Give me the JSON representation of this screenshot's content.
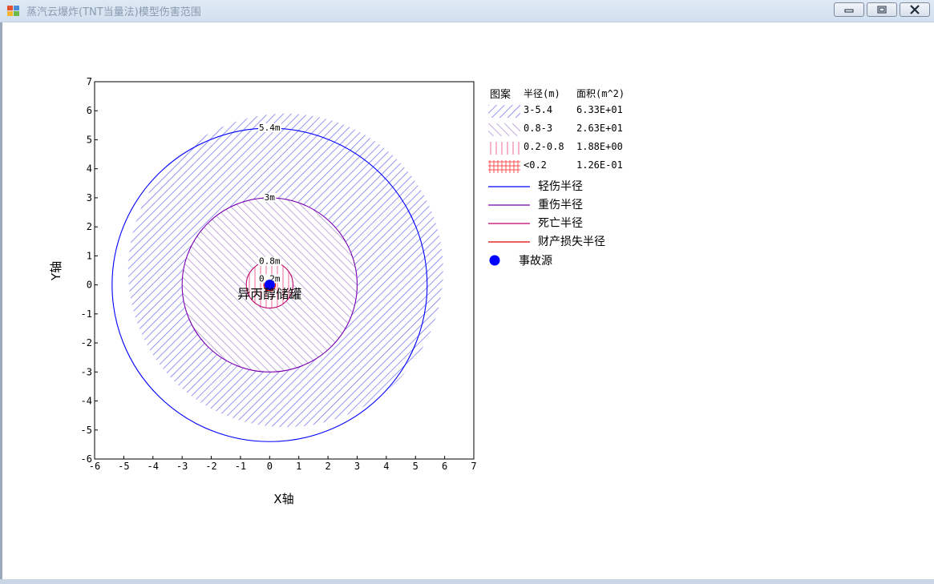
{
  "window": {
    "title": "蒸汽云爆炸(TNT当量法)模型伤害范围",
    "minimize_icon": "minimize-icon",
    "maximize_icon": "maximize-icon",
    "close_icon": "close-icon"
  },
  "chart_data": {
    "type": "scatter",
    "xlabel": "X轴",
    "ylabel": "Y轴",
    "xlim": [
      -6,
      7
    ],
    "ylim": [
      -6,
      7
    ],
    "xticks": [
      -6,
      -5,
      -4,
      -3,
      -2,
      -1,
      0,
      1,
      2,
      3,
      4,
      5,
      6,
      7
    ],
    "yticks": [
      -6,
      -5,
      -4,
      -3,
      -2,
      -1,
      0,
      1,
      2,
      3,
      4,
      5,
      6,
      7
    ],
    "grid": false,
    "source": {
      "x": 0,
      "y": 0,
      "label": "异丙醇储罐"
    },
    "zones": [
      {
        "range": "3-5.4",
        "inner": 3,
        "outer": 5.4,
        "area": "6.33E+01",
        "pattern": "forward-hatch",
        "color": "#7b7bf2"
      },
      {
        "range": "0.8-3",
        "inner": 0.8,
        "outer": 3,
        "area": "2.63E+01",
        "pattern": "back-hatch",
        "color": "#a78ad0"
      },
      {
        "range": "0.2-0.8",
        "inner": 0.2,
        "outer": 0.8,
        "area": "1.88E+00",
        "pattern": "vertical",
        "color": "#ef80a8"
      },
      {
        "range": "<0.2",
        "inner": 0,
        "outer": 0.2,
        "area": "1.26E-01",
        "pattern": "cross",
        "color": "#ff4d4d"
      }
    ],
    "circles": [
      {
        "name": "轻伤半径",
        "radius": 5.4,
        "label": "5.4m",
        "color": "#0000ff"
      },
      {
        "name": "重伤半径",
        "radius": 3,
        "label": "3m",
        "color": "#7a00b0"
      },
      {
        "name": "死亡半径",
        "radius": 0.8,
        "label": "0.8m",
        "color": "#c0006a"
      },
      {
        "name": "财产损失半径",
        "radius": 0.2,
        "label": "0.2m",
        "color": "#e00000"
      }
    ]
  },
  "legend": {
    "header_pattern": "图案",
    "header_radius": "半径(m)",
    "header_area": "面积(m^2)",
    "source_label": "事故源",
    "source_color": "#0000ff"
  }
}
